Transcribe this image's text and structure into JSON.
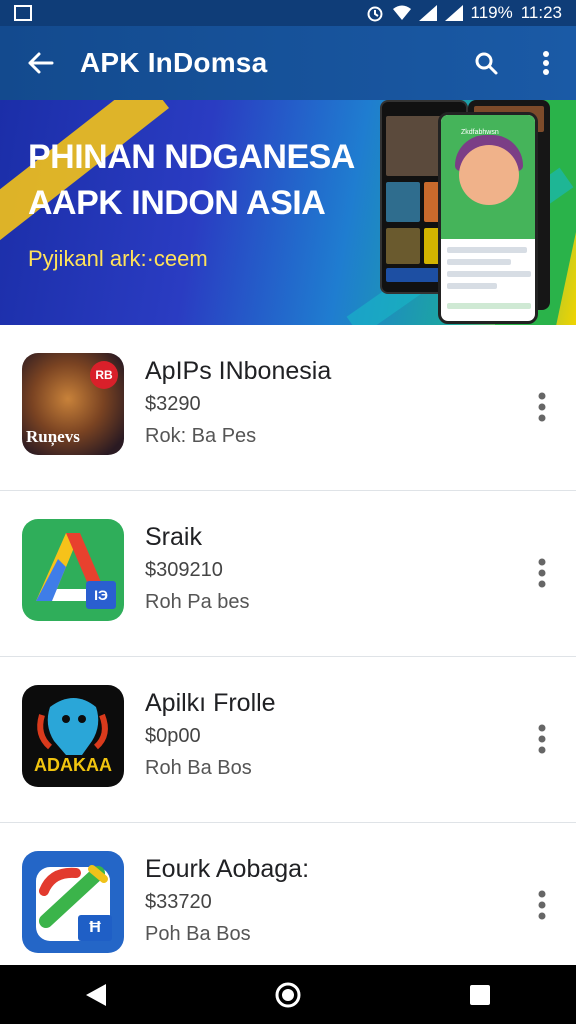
{
  "status_bar": {
    "battery": "119%",
    "time": "11:23"
  },
  "app_bar": {
    "title": "APK InDomsa",
    "icons": [
      "back-arrow-icon",
      "share-icon",
      "more-vert-icon"
    ]
  },
  "banner": {
    "line1": "PHINAN NDGANESA",
    "line2": "AAPK INDON ASIA",
    "subtitle": "Pyjikanl ark:·ceem",
    "phone_label": "Zkdfabhwsn"
  },
  "apps": [
    {
      "name": "ApIPs INbonesia",
      "price": "$3290",
      "sub": "Rok: Ba Pes",
      "icon_text": "Ruņevs",
      "badge": "RB"
    },
    {
      "name": "Sraik",
      "price": "$309210",
      "sub": "Roh Pa bes",
      "icon_text": "",
      "badge": "IЭ"
    },
    {
      "name": "Apilkı Frolle",
      "price": "$0p00",
      "sub": "Roh Ba Bos",
      "icon_text": "ADAKAA",
      "badge": ""
    },
    {
      "name": "Eourk Aobaga:",
      "price": "$33720",
      "sub": "Poh Ba Bos",
      "icon_text": "",
      "badge": "Ħ"
    }
  ],
  "colors": {
    "status_bar": "#0f3d78",
    "app_bar": "#134a8e",
    "accent_yellow": "#ffe25a",
    "nav_bar": "#000000"
  }
}
